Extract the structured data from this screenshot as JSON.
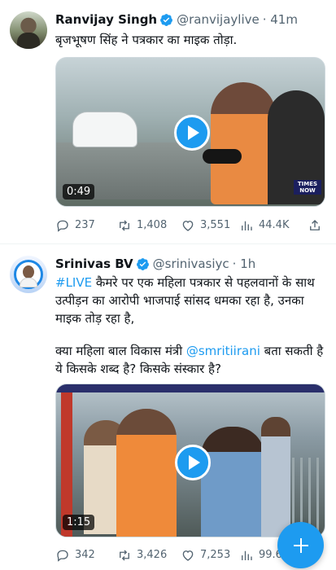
{
  "tweets": [
    {
      "name": "Ranvijay Singh",
      "handle": "@ranvijaylive",
      "time": "· 41m",
      "text": "बृजभूषण सिंह ने पत्रकार का माइक तोड़ा.",
      "video": {
        "duration": "0:49",
        "channel_logo": "TIMES NOW"
      },
      "stats": {
        "replies": "237",
        "retweets": "1,408",
        "likes": "3,551",
        "views": "44.4K"
      }
    },
    {
      "name": "Srinivas BV",
      "handle": "@srinivasiyc",
      "time": "· 1h",
      "hashtag": "#LIVE",
      "text_line1": " कैमरे पर एक महिला पत्रकार से पहलवानों के साथ",
      "text_line2": "उत्पीड़न का आरोपी भाजपाई सांसद धमका रहा है, उनका",
      "text_line3": "माइक तोड़ रहा है,",
      "text_line4_pre": "क्या महिला बाल विकास मंत्री ",
      "mention": "@smritiirani",
      "text_line4_post": " बता सकती है",
      "text_line5": "ये किसके शब्द है? किसके संस्कार है?",
      "video": {
        "duration": "1:15"
      },
      "stats": {
        "replies": "342",
        "retweets": "3,426",
        "likes": "7,253",
        "views": "99.6"
      }
    }
  ],
  "icons": {
    "verified": "verified-badge-icon",
    "reply": "reply-icon",
    "retweet": "retweet-icon",
    "like": "heart-icon",
    "views": "views-bar-chart-icon",
    "share": "share-icon",
    "play": "play-icon",
    "compose": "plus-icon"
  },
  "colors": {
    "accent": "#1d9bf0",
    "text": "#0f1419",
    "secondary": "#536471",
    "divider": "#eff3f4"
  }
}
